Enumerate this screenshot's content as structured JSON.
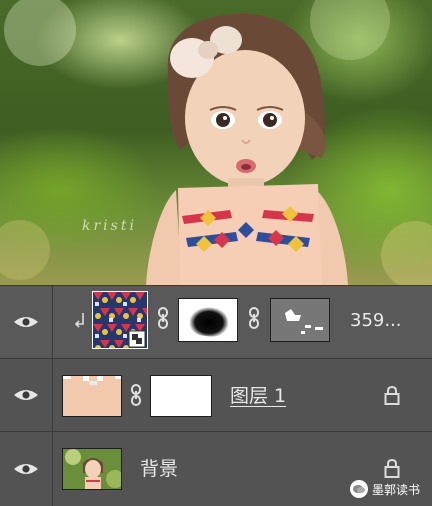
{
  "canvas": {
    "watermark": "kristi",
    "accent_pattern_colors": [
      "#d7354a",
      "#2d4e9a",
      "#f0c23c"
    ]
  },
  "layers": [
    {
      "name": "",
      "clipped": true,
      "thumbnails": [
        "pattern-thumb",
        "vector-mask-thumb",
        "layer-mask-thumb"
      ],
      "value": "359..."
    },
    {
      "name": "图层 1",
      "locked": true,
      "thumbnails": [
        "skin-fill-thumb",
        "white-mask-thumb"
      ]
    },
    {
      "name": "背景",
      "locked": true,
      "thumbnails": [
        "background-photo-thumb"
      ]
    }
  ],
  "icons": {
    "visibility": "eye-icon",
    "link": "chain-link-icon",
    "lock": "lock-icon",
    "clip": "clipping-arrow-icon"
  },
  "badge": {
    "label": "墨郭读书"
  }
}
